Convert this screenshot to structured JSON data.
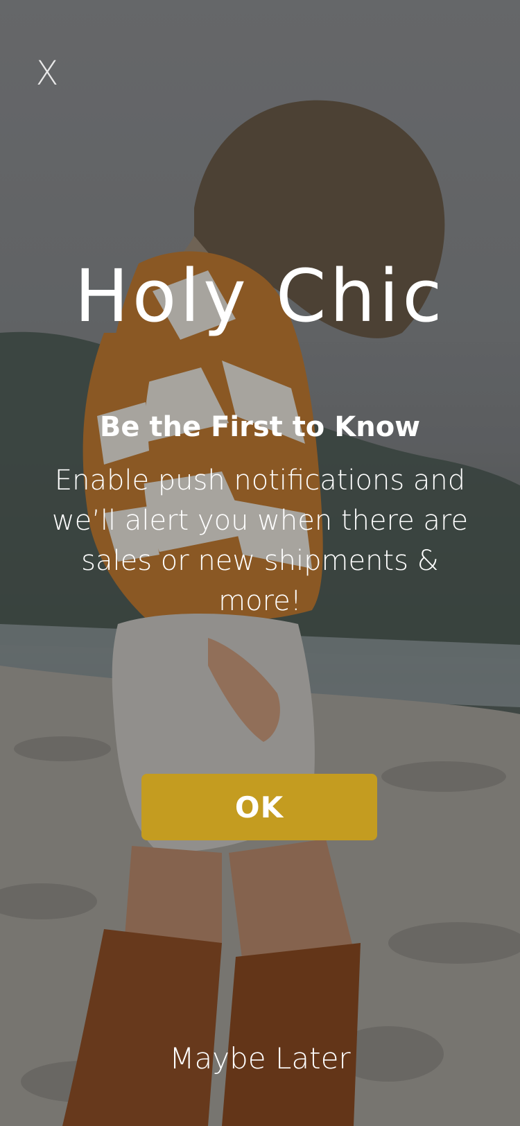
{
  "popup": {
    "close_label": "X",
    "brand": "Holy Chic",
    "headline": "Be the First to Know",
    "body": "Enable push notifications and we’ll alert you when there are sales or new shipments & more!",
    "ok_label": "OK",
    "later_label": "Maybe Later"
  },
  "colors": {
    "ok_button": "#c49c20",
    "text": "#ffffff"
  },
  "icons": {
    "close": "close-icon"
  }
}
